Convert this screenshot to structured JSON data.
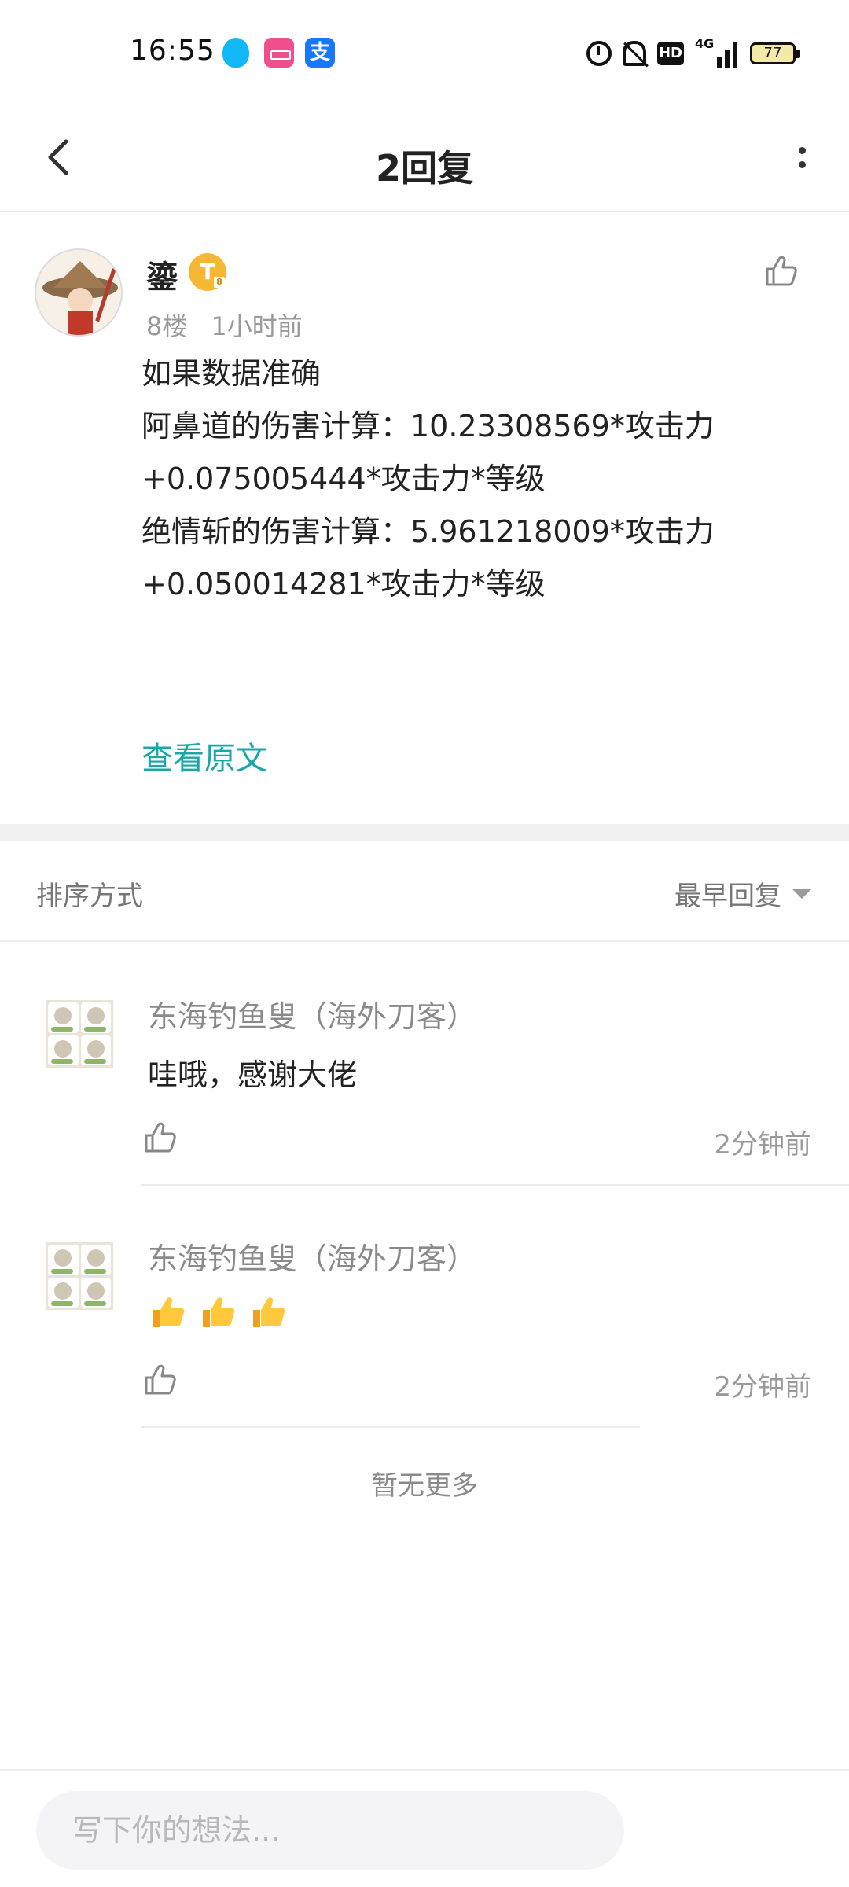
{
  "status_bar": {
    "time": "16:55",
    "network_label": "4G",
    "battery": "77",
    "apps": [
      "qq-icon",
      "pink-app-icon",
      "alipay-icon"
    ],
    "alipay_glyph": "支"
  },
  "header": {
    "title": "2回复"
  },
  "post": {
    "username": "鎏",
    "badge": "T",
    "floor": "8楼",
    "time": "1小时前",
    "lines": [
      "如果数据准确",
      "阿鼻道的伤害计算：10.23308569*攻击力",
      "+0.075005444*攻击力*等级",
      "绝情斩的伤害计算：5.961218009*攻击力",
      "+0.050014281*攻击力*等级"
    ],
    "view_original": "查看原文"
  },
  "sort": {
    "label": "排序方式",
    "value": "最早回复"
  },
  "replies": [
    {
      "name": "东海钓鱼叟（海外刀客）",
      "text": "哇哦，感谢大佬",
      "time": "2分钟前"
    },
    {
      "name": "东海钓鱼叟（海外刀客）",
      "text": "",
      "emoji": [
        "thumbs-up",
        "thumbs-up",
        "thumbs-up"
      ],
      "time": "2分钟前"
    }
  ],
  "footer": {
    "no_more": "暂无更多",
    "input_placeholder": "写下你的想法..."
  },
  "colors": {
    "accent_link": "#19a8a8",
    "badge": "#f6b733",
    "divider": "#f0f0f0"
  }
}
